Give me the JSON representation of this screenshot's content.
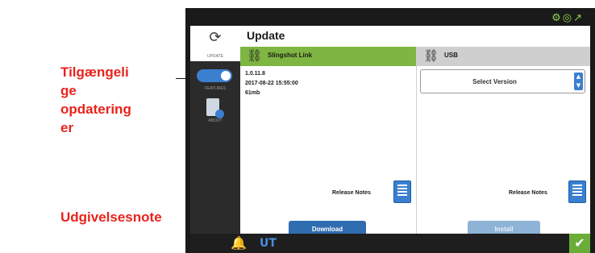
{
  "callouts": {
    "available_updates": [
      "Tilgængeli",
      "ge",
      "opdatering",
      "er"
    ],
    "release_note": "Udgivelsesnote"
  },
  "colors": {
    "accent_green": "#7fb542",
    "accent_blue": "#2f6cb0",
    "callout_red": "#e8231c"
  },
  "status_icons": [
    "settings-icon",
    "gps-icon",
    "signal-icon"
  ],
  "sidebar": {
    "items": [
      {
        "icon": "update-icon",
        "label": "UPDATE"
      },
      {
        "icon": "toggle-icon",
        "label": "FEATURES"
      },
      {
        "icon": "document-icon",
        "label": "ABOUT"
      }
    ]
  },
  "page": {
    "title": "Update"
  },
  "slingshot": {
    "header": "Slingshot Link",
    "version": "1.0.11.8",
    "date": "2017-08-22 15:55:00",
    "size": "61mb",
    "release_notes": "Release Notes",
    "download": "Download"
  },
  "usb": {
    "header": "USB",
    "select_placeholder": "Select Version",
    "release_notes": "Release Notes",
    "install": "Install"
  },
  "bottombar": {
    "icons": [
      "bell-icon",
      "unit-icon",
      "check-icon"
    ]
  }
}
